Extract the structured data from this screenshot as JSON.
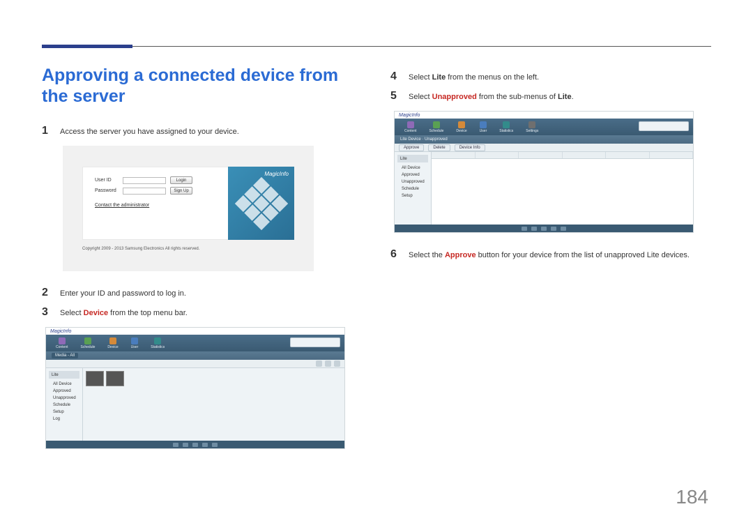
{
  "page": {
    "title": "Approving a connected device from the server",
    "number": "184"
  },
  "steps": {
    "s1": {
      "num": "1",
      "text": "Access the server you have assigned to your device."
    },
    "s2": {
      "num": "2",
      "text": "Enter your ID and password to log in."
    },
    "s3": {
      "num": "3",
      "pre": "Select ",
      "bold": "Device",
      "post": " from the top menu bar."
    },
    "s4": {
      "num": "4",
      "pre": "Select ",
      "bold": "Lite",
      "post": " from the menus on the left."
    },
    "s5": {
      "num": "5",
      "pre": "Select ",
      "bold": "Unapproved",
      "post_pre": " from the sub-menus of ",
      "bold2": "Lite",
      "end": "."
    },
    "s6": {
      "num": "6",
      "pre": "Select the ",
      "bold": "Approve",
      "post": " button for your device from the list of unapproved Lite devices."
    }
  },
  "login": {
    "user_label": "User ID",
    "pass_label": "Password",
    "login_btn": "Login",
    "signup_btn": "Sign Up",
    "admin_link": "Contact the administrator",
    "brand": "MagicInfo",
    "copyright": "Copyright 2009 - 2013 Samsung Electronics All rights reserved."
  },
  "app": {
    "brand": "MagicInfo",
    "nav": [
      "Content",
      "Schedule",
      "Device",
      "User",
      "Statistics",
      "Settings"
    ],
    "icon_colors": [
      "#8e6ab7",
      "#5aa053",
      "#d48a3a",
      "#4a7dbd",
      "#338b8b",
      "#6f6f6f"
    ],
    "sidebar_head": "Lite",
    "sidebar_items": [
      "All Device",
      "Approved",
      "Unapproved",
      "Schedule",
      "Setup",
      "Log"
    ],
    "sub_label": "Media - All",
    "sub2_label": "Lite Device · Unapproved",
    "sub2_buttons": [
      "Approve",
      "Delete",
      "Device Info"
    ]
  }
}
